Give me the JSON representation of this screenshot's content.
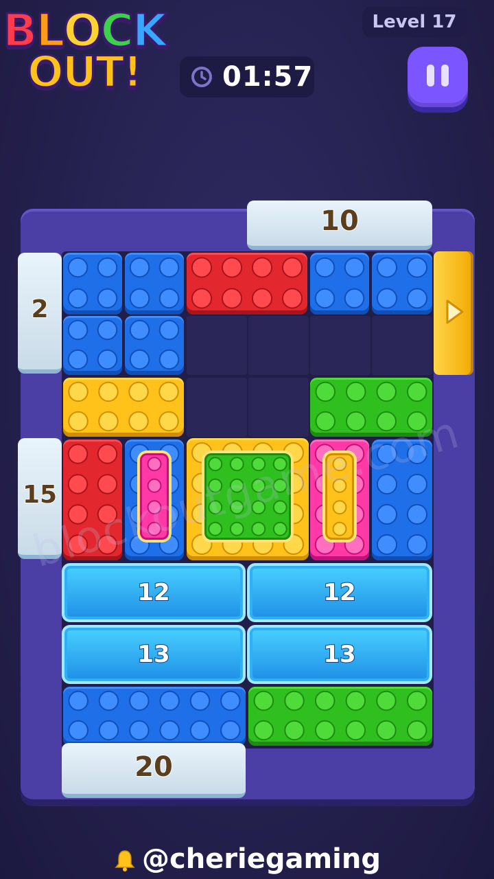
{
  "header": {
    "logo_line1": "BLOCK",
    "logo_line2": "OUT!",
    "level": "Level 17",
    "timer": "01:57"
  },
  "board": {
    "ice_blocks": {
      "top": "10",
      "left_upper": "2",
      "left_lower": "15",
      "bottom": "20"
    },
    "crystal_blocks": {
      "row1_left": "12",
      "row1_right": "12",
      "row2_left": "13",
      "row2_right": "13"
    }
  },
  "watermark": "blockoutgame.com",
  "handle": "@cheriegaming",
  "colors": {
    "blue": "#1f6fe8",
    "red": "#e2282e",
    "yellow": "#ffc21a",
    "green": "#2fbf1e",
    "pink": "#ff3aa6",
    "board": "#4b3fa5",
    "background": "#25214f"
  }
}
